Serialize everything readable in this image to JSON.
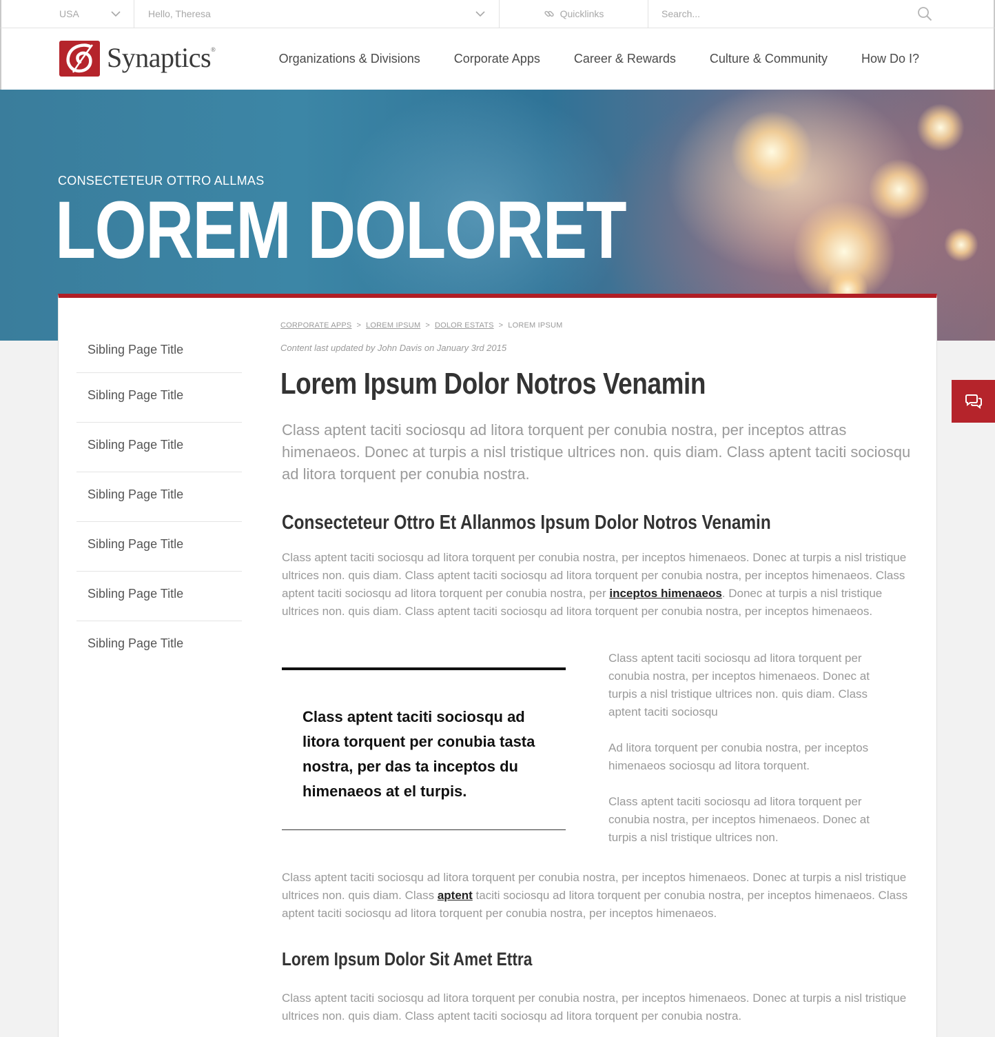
{
  "utility": {
    "country": "USA",
    "greeting": "Hello, Theresa",
    "quicklinks": "Quicklinks",
    "search_placeholder": "Search..."
  },
  "brand": {
    "name": "Synaptics",
    "registered": "®",
    "color": "#b5242b"
  },
  "nav": [
    "Organizations & Divisions",
    "Corporate Apps",
    "Career & Rewards",
    "Culture & Community",
    "How Do I?"
  ],
  "hero": {
    "eyebrow": "CONSECTETEUR OTTRO ALLMAS",
    "title": "LOREM DOLORET"
  },
  "sidebar": [
    "Sibling Page Title",
    "Sibling Page Title",
    "Sibling Page Title",
    "Sibling Page Title",
    "Sibling Page Title",
    "Sibling Page Title",
    "Sibling Page Title"
  ],
  "breadcrumb": {
    "links": [
      "CORPORATE APPS",
      "LOREM IPSUM",
      "DOLOR ESTATS"
    ],
    "current": "LOREM IPSUM",
    "separator": ">"
  },
  "updated": "Content last updated by John Davis on January 3rd 2015",
  "title": "Lorem Ipsum Dolor Notros Venamin",
  "lead": "Class aptent taciti sociosqu ad litora torquent per conubia nostra, per inceptos attras himenaeos. Donec at turpis a nisl tristique ultrices non. quis diam. Class aptent taciti sociosqu ad litora torquent per conubia nostra.",
  "section1": {
    "heading": "Consecteteur Ottro Et Allanmos Ipsum Dolor Notros Venamin",
    "para_before": "Class aptent taciti sociosqu ad litora torquent per conubia nostra, per inceptos himenaeos. Donec at turpis a nisl tristique ultrices non. quis diam. Class aptent taciti sociosqu ad litora torquent per conubia nostra, per inceptos himenaeos. Class aptent taciti sociosqu ad litora torquent per conubia nostra, per ",
    "link": "inceptos himenaeos",
    "para_after": ". Donec at turpis a nisl tristique ultrices non. quis diam. Class aptent taciti sociosqu ad litora torquent per conubia nostra, per inceptos himenaeos."
  },
  "pullquote": "Class aptent taciti sociosqu ad litora torquent per conubia tasta nostra, per das ta inceptos du himenaeos at el turpis.",
  "column": [
    "Class aptent taciti sociosqu ad litora torquent per conubia nostra, per inceptos himenaeos. Donec at turpis a nisl tristique ultrices non. quis diam. Class aptent taciti sociosqu",
    "Ad litora torquent per conubia nostra, per inceptos himenaeos sociosqu ad litora torquent.",
    "Class aptent taciti sociosqu ad litora torquent per conubia nostra, per inceptos himenaeos. Donec at turpis a nisl tristique ultrices non."
  ],
  "para2": {
    "before": "Class aptent taciti sociosqu ad litora torquent per conubia nostra, per inceptos himenaeos. Donec at turpis a nisl tristique ultrices non. quis diam. Class ",
    "link": "aptent",
    "after": " taciti sociosqu ad litora torquent per conubia nostra, per inceptos himenaeos. Class aptent taciti sociosqu ad litora torquent per conubia nostra, per inceptos himenaeos."
  },
  "section2": {
    "heading": "Lorem Ipsum Dolor Sit Amet Ettra",
    "para": "Class aptent taciti sociosqu ad litora torquent per conubia nostra, per inceptos himenaeos. Donec at turpis a nisl tristique ultrices non. quis diam. Class aptent taciti sociosqu ad litora torquent per conubia nostra."
  },
  "icons": [
    "chevron-down-icon",
    "link-icon",
    "search-icon",
    "chat-icon"
  ]
}
